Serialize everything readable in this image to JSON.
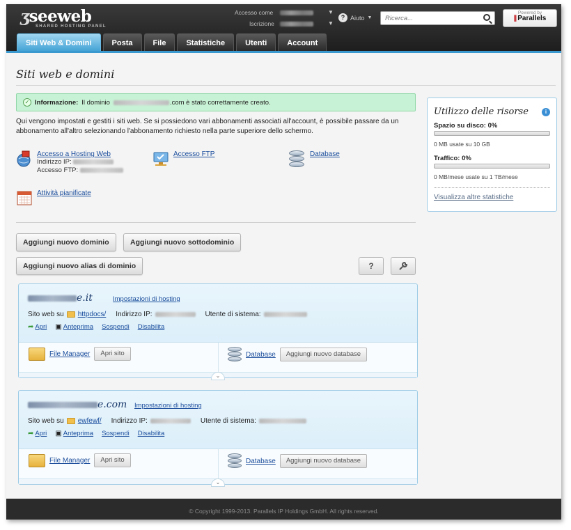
{
  "header": {
    "logo": "seeweb",
    "logo_subtitle": "SHARED HOSTING PANEL",
    "access_label": "Accesso come",
    "subscription_label": "Iscrizione",
    "help_label": "Aiuto",
    "search_placeholder": "Ricerca...",
    "parallels_powered": "Powered by",
    "parallels_name": "Parallels"
  },
  "tabs": [
    {
      "label": "Siti Web & Domini",
      "active": true
    },
    {
      "label": "Posta",
      "active": false
    },
    {
      "label": "File",
      "active": false
    },
    {
      "label": "Statistiche",
      "active": false
    },
    {
      "label": "Utenti",
      "active": false
    },
    {
      "label": "Account",
      "active": false
    }
  ],
  "page": {
    "title": "Siti web e domini",
    "info_label": "Informazione:",
    "info_prefix": "Il dominio",
    "info_suffix": ".com è stato correttamente creato.",
    "intro": "Qui vengono impostati e gestiti i siti web. Se si possiedono vari abbonamenti associati all'account, è possibile passare da un abbonamento all'altro selezionando l'abbonamento richiesto nella parte superiore dello schermo."
  },
  "tools": {
    "hosting_access": "Accesso a Hosting Web",
    "ip_label": "Indirizzo IP:",
    "ftp_label": "Accesso FTP:",
    "ftp_access": "Accesso FTP",
    "database": "Database",
    "scheduled": "Attività pianificate"
  },
  "buttons": {
    "add_domain": "Aggiungi nuovo dominio",
    "add_subdomain": "Aggiungi nuovo sottodominio",
    "add_alias": "Aggiungi nuovo alias di dominio",
    "help": "?"
  },
  "domains": [
    {
      "name_visible": "e.it",
      "settings": "Impostazioni di hosting",
      "site_label": "Sito web su",
      "folder": "httpdocs/",
      "ip_label": "Indirizzo IP:",
      "user_label": "Utente di sistema:",
      "open": "Apri",
      "preview": "Anteprima",
      "suspend": "Sospendi",
      "disable": "Disabilita",
      "file_manager": "File Manager",
      "open_site": "Apri sito",
      "database": "Database",
      "add_db": "Aggiungi nuovo database"
    },
    {
      "name_visible": "e.com",
      "settings": "Impostazioni di hosting",
      "site_label": "Sito web su",
      "folder": "ewfewf/",
      "ip_label": "Indirizzo IP:",
      "user_label": "Utente di sistema:",
      "open": "Apri",
      "preview": "Anteprima",
      "suspend": "Sospendi",
      "disable": "Disabilita",
      "file_manager": "File Manager",
      "open_site": "Apri sito",
      "database": "Database",
      "add_db": "Aggiungi nuovo database"
    }
  ],
  "resources": {
    "title": "Utilizzo delle risorse",
    "disk_label": "Spazio su disco: 0%",
    "disk_used_pct": 0,
    "disk_text": "0 MB usate su 10 GB",
    "traffic_label": "Traffico: 0%",
    "traffic_used_pct": 0,
    "traffic_text": "0 MB/mese usate su 1 TB/mese",
    "more_stats": "Visualizza altre statistiche"
  },
  "footer": "© Copyright 1999-2013. Parallels IP Holdings GmbH. All rights reserved."
}
